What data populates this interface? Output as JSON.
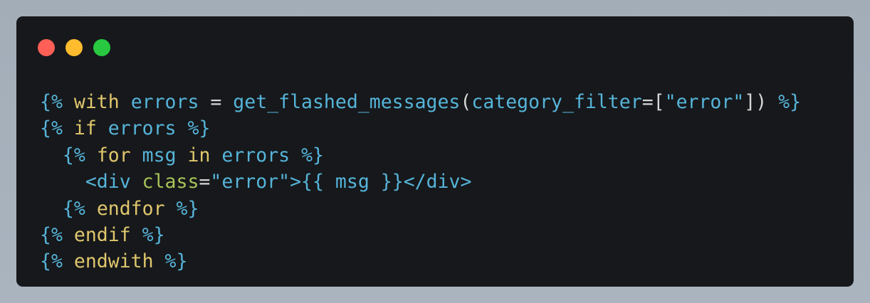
{
  "window": {
    "controls": [
      "close",
      "minimize",
      "maximize"
    ],
    "colors": {
      "background": "#16181b",
      "close": "#ff5f57",
      "minimize": "#febc2e",
      "maximize": "#28c840",
      "delimiter": "#56b4d9",
      "keyword": "#e0c76d",
      "attribute": "#a8c458",
      "operator": "#d6d6d6"
    }
  },
  "code": {
    "lines": [
      [
        {
          "type": "delim",
          "text": "{%"
        },
        {
          "type": "op",
          "text": " "
        },
        {
          "type": "kw",
          "text": "with"
        },
        {
          "type": "op",
          "text": " "
        },
        {
          "type": "ident",
          "text": "errors"
        },
        {
          "type": "op",
          "text": " = "
        },
        {
          "type": "ident",
          "text": "get_flashed_messages"
        },
        {
          "type": "op",
          "text": "("
        },
        {
          "type": "ident",
          "text": "category_filter"
        },
        {
          "type": "op",
          "text": "=["
        },
        {
          "type": "str",
          "text": "\"error\""
        },
        {
          "type": "op",
          "text": "]) "
        },
        {
          "type": "delim",
          "text": "%}"
        }
      ],
      [
        {
          "type": "delim",
          "text": "{%"
        },
        {
          "type": "op",
          "text": " "
        },
        {
          "type": "kw",
          "text": "if"
        },
        {
          "type": "op",
          "text": " "
        },
        {
          "type": "ident",
          "text": "errors"
        },
        {
          "type": "op",
          "text": " "
        },
        {
          "type": "delim",
          "text": "%}"
        }
      ],
      [
        {
          "type": "op",
          "text": "  "
        },
        {
          "type": "delim",
          "text": "{%"
        },
        {
          "type": "op",
          "text": " "
        },
        {
          "type": "kw",
          "text": "for"
        },
        {
          "type": "op",
          "text": " "
        },
        {
          "type": "ident",
          "text": "msg"
        },
        {
          "type": "op",
          "text": " "
        },
        {
          "type": "kw",
          "text": "in"
        },
        {
          "type": "op",
          "text": " "
        },
        {
          "type": "ident",
          "text": "errors"
        },
        {
          "type": "op",
          "text": " "
        },
        {
          "type": "delim",
          "text": "%}"
        }
      ],
      [
        {
          "type": "op",
          "text": "    "
        },
        {
          "type": "tag",
          "text": "<div"
        },
        {
          "type": "op",
          "text": " "
        },
        {
          "type": "attr",
          "text": "class"
        },
        {
          "type": "op",
          "text": "="
        },
        {
          "type": "str",
          "text": "\"error\""
        },
        {
          "type": "tag",
          "text": ">"
        },
        {
          "type": "delim",
          "text": "{{"
        },
        {
          "type": "op",
          "text": " "
        },
        {
          "type": "ident",
          "text": "msg"
        },
        {
          "type": "op",
          "text": " "
        },
        {
          "type": "delim",
          "text": "}}"
        },
        {
          "type": "tag",
          "text": "</div>"
        }
      ],
      [
        {
          "type": "op",
          "text": "  "
        },
        {
          "type": "delim",
          "text": "{%"
        },
        {
          "type": "op",
          "text": " "
        },
        {
          "type": "kw",
          "text": "endfor"
        },
        {
          "type": "op",
          "text": " "
        },
        {
          "type": "delim",
          "text": "%}"
        }
      ],
      [
        {
          "type": "delim",
          "text": "{%"
        },
        {
          "type": "op",
          "text": " "
        },
        {
          "type": "kw",
          "text": "endif"
        },
        {
          "type": "op",
          "text": " "
        },
        {
          "type": "delim",
          "text": "%}"
        }
      ],
      [
        {
          "type": "delim",
          "text": "{%"
        },
        {
          "type": "op",
          "text": " "
        },
        {
          "type": "kw",
          "text": "endwith"
        },
        {
          "type": "op",
          "text": " "
        },
        {
          "type": "delim",
          "text": "%}"
        }
      ]
    ]
  }
}
